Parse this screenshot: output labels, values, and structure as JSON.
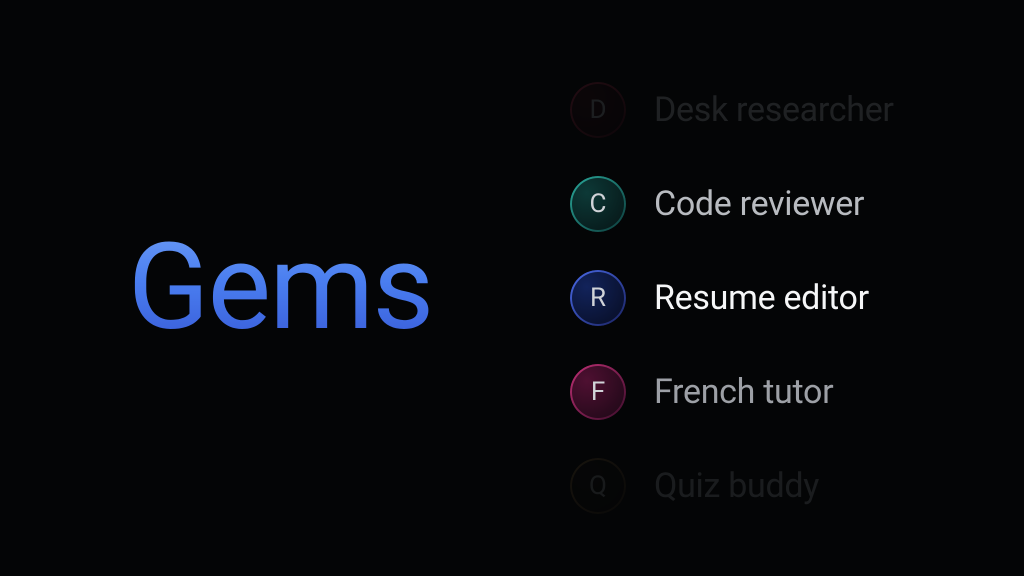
{
  "title": "Gems",
  "items": [
    {
      "letter": "D",
      "label": "Desk researcher"
    },
    {
      "letter": "C",
      "label": "Code reviewer"
    },
    {
      "letter": "R",
      "label": "Resume editor"
    },
    {
      "letter": "F",
      "label": "French tutor"
    },
    {
      "letter": "Q",
      "label": "Quiz buddy"
    }
  ]
}
